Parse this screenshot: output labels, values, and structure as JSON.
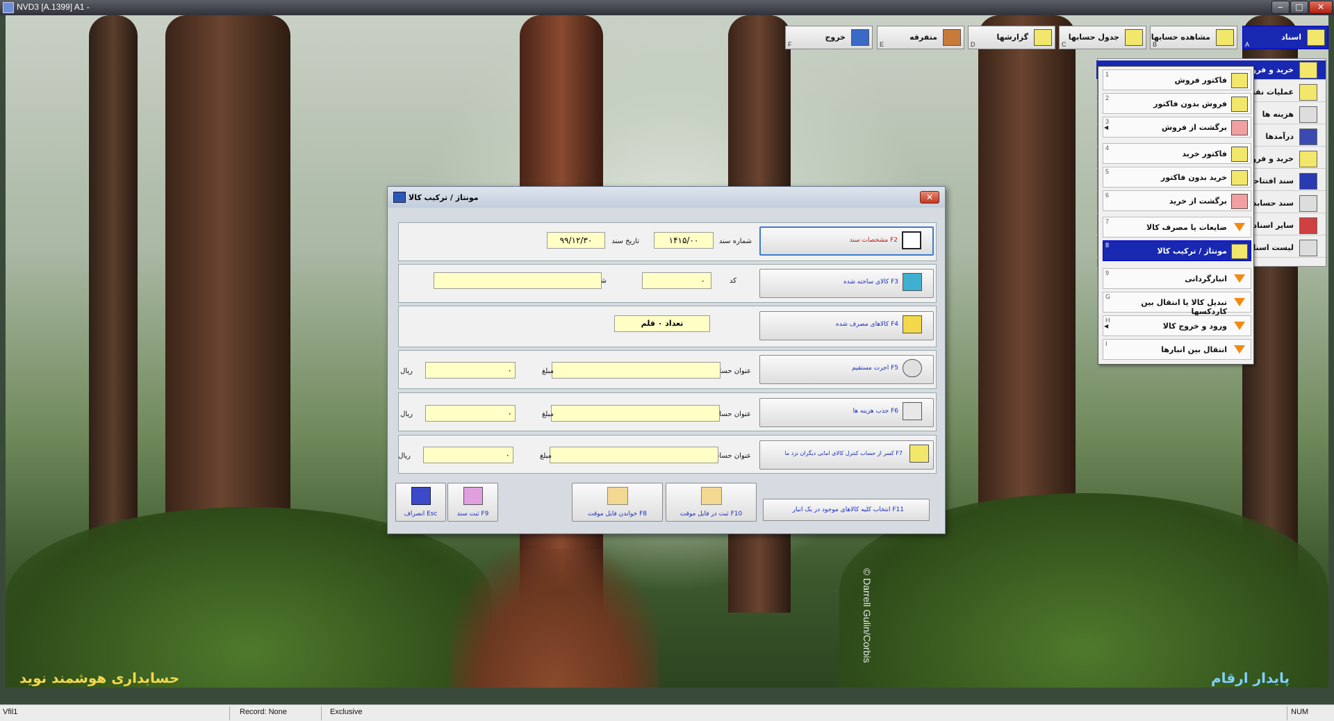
{
  "window": {
    "title": "NVD3 [A.1399] A1 -",
    "min": "‒",
    "max": "□",
    "close": "✕"
  },
  "top_menu": [
    {
      "key": "A",
      "label": "اسناد",
      "active": true
    },
    {
      "key": "B",
      "label": "مشاهده حسابها"
    },
    {
      "key": "C",
      "label": "جدول حسابها"
    },
    {
      "key": "D",
      "label": "گزارشها"
    },
    {
      "key": "E",
      "label": "متفرقه"
    },
    {
      "key": "F",
      "label": "خروج"
    }
  ],
  "side_menu": [
    {
      "label": "خرید و فروش",
      "active": true
    },
    {
      "label": "عملیات نقدی"
    },
    {
      "label": "هزینه ها"
    },
    {
      "label": "درآمدها"
    },
    {
      "label": "خرید و فروش"
    },
    {
      "label": "سند افتتاحیه"
    },
    {
      "label": "سند حسابداری"
    },
    {
      "label": "سایر اسناد"
    },
    {
      "label": "لیست اسناد"
    }
  ],
  "submenu": [
    {
      "key": "1",
      "label": "فاکتور فروش"
    },
    {
      "key": "2",
      "label": "فروش بدون فاکتور"
    },
    {
      "key": "3",
      "label": "برگشت از فروش",
      "arrow": "◀"
    },
    {
      "key": "4",
      "label": "فاکتور خرید"
    },
    {
      "key": "5",
      "label": "خرید بدون فاکتور"
    },
    {
      "key": "6",
      "label": "برگشت از خرید"
    },
    {
      "key": "7",
      "label": "ضایعات یا مصرف کالا"
    },
    {
      "key": "8",
      "label": "مونتاژ / ترکیب کالا",
      "active": true
    },
    {
      "key": "9",
      "label": "انبارگردانی"
    },
    {
      "key": "G",
      "label": "تبدیل کالا یا انتقال بین کاردکسها"
    },
    {
      "key": "H",
      "label": "ورود و خروج کالا",
      "arrow": "◀"
    },
    {
      "key": "I",
      "label": "انتقال بین انبارها"
    }
  ],
  "dialog": {
    "title": "مونتاژ / ترکیب کالا",
    "close": "✕",
    "doc": {
      "button": "F2   مشخصات سند",
      "number_label": "شماره سند",
      "number": "۱۴۱۵/۰۰",
      "date_label": "تاریخ سند",
      "date": "۹۹/۱۲/۳۰"
    },
    "product": {
      "button": "F3   کالای ساخته شده",
      "code_label": "کد",
      "code": "۰",
      "desc_label": "شرح",
      "desc": ""
    },
    "consumed": {
      "button": "F4   کالاهای مصرف شده",
      "count": "تعداد ۰ قلم"
    },
    "direct_wage": {
      "button": "F5   اجرت مستقیم",
      "account_label": "عنوان حساب",
      "account": "",
      "amount_label": "مبلغ",
      "amount": "۰",
      "currency": "ریال"
    },
    "overhead": {
      "button": "F6   جذب هزینه ها",
      "account_label": "عنوان حساب",
      "account": "",
      "amount_label": "مبلغ",
      "amount": "۰",
      "currency": "ریال"
    },
    "deduction": {
      "button": "F7 کسر از حساب کنترل کالای امانی دیگران نزد ما",
      "account_label": "عنوان حساب",
      "account": "",
      "amount_label": "مبلغ",
      "amount": "۰",
      "currency": "ریال"
    },
    "actions": {
      "select_all": "F11   انتخاب کلیه کالاهای موجود در یک انبار",
      "save_temp": "F10   ثبت در فایل موقت",
      "read_temp": "F8 خواندن فایل موقت",
      "save": "F9   ثبت سند",
      "cancel": "Esc   انصراف"
    }
  },
  "desktop": {
    "brand_left": "حسابداری هوشمند نوید",
    "brand_right": "پایدار ارقام",
    "watermark": "© Darrell Gulin/Corbis"
  },
  "status": {
    "left": "Vfil1",
    "record": "Record: None",
    "mode": "Exclusive",
    "num": "NUM"
  },
  "colors": {
    "active_blue": "#1828b0",
    "field_yellow": "#ffffc6",
    "brand_left": "#f4d94a",
    "brand_right": "#7fd1ff"
  }
}
